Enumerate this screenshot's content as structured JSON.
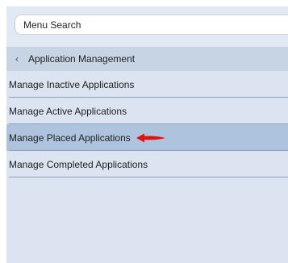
{
  "search": {
    "placeholder": "Menu Search"
  },
  "header": {
    "label": "Application Management"
  },
  "items": [
    {
      "label": "Manage Inactive Applications"
    },
    {
      "label": "Manage Active Applications"
    },
    {
      "label": "Manage Placed Applications"
    },
    {
      "label": "Manage Completed Applications"
    }
  ],
  "selected_index": 2,
  "colors": {
    "panel_bg": "#dbe4f0",
    "header_bg": "#c7d4e4",
    "selected_bg": "#aec3de",
    "arrow": "#e3100c"
  },
  "icons": {
    "header": "chevron-left-icon",
    "annotation": "red-arrow-icon"
  }
}
